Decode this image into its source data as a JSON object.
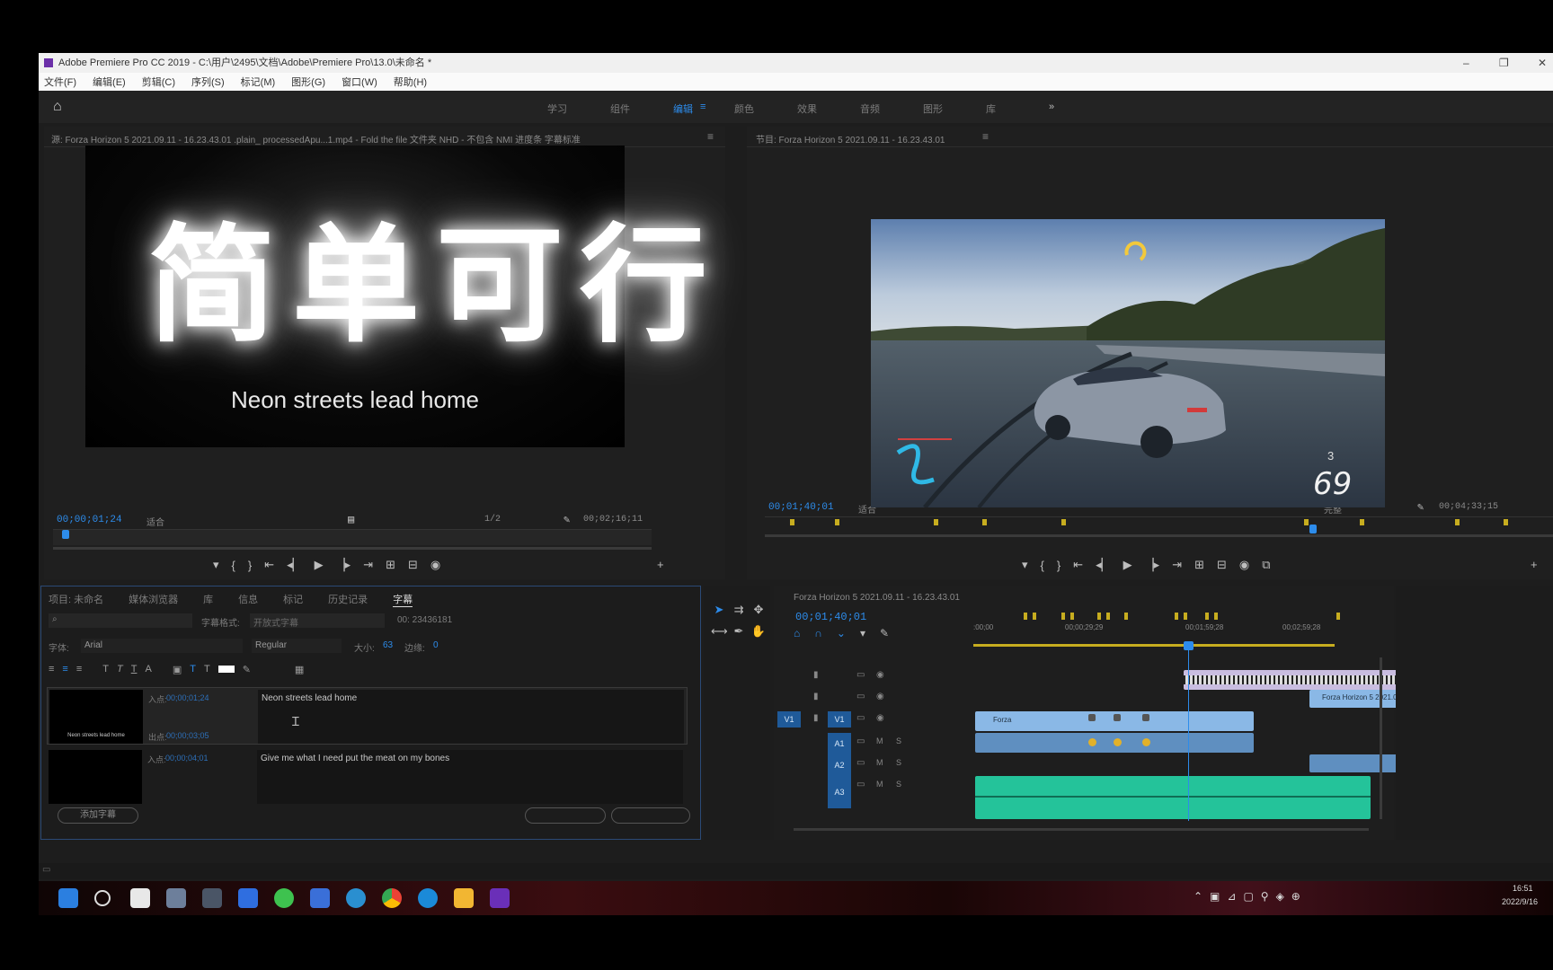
{
  "window": {
    "title": "Adobe Premiere Pro CC 2019 - C:\\用户\\2495\\文档\\Adobe\\Premiere Pro\\13.0\\未命名 *",
    "controls": [
      "–",
      "❐",
      "✕"
    ]
  },
  "menu": [
    "文件(F)",
    "编辑(E)",
    "剪辑(C)",
    "序列(S)",
    "标记(M)",
    "图形(G)",
    "窗口(W)",
    "帮助(H)"
  ],
  "workspaces": {
    "items": [
      "学习",
      "组件",
      "编辑",
      "颜色",
      "效果",
      "音频",
      "图形",
      "库"
    ],
    "active": "编辑",
    "more": "»"
  },
  "source": {
    "tab": "源: Forza Horizon 5 2021.09.11 - 16.23.43.01 .plain_ processedApu...1.mp4 - Fold the file 文件夹 NHD - 不包含 NMI 进度条 字幕标准",
    "close": "≡",
    "overlay_title": "简单可行",
    "caption": "Neon streets lead home",
    "timecode_left": "00;00;01;24",
    "fit": "适合",
    "quality": "1/2",
    "timecode_right": "00;02;16;11"
  },
  "program": {
    "tab": "节目: Forza Horizon 5 2021.09.11 - 16.23.43.01",
    "close": "≡",
    "timecode_left": "00;01;40;01",
    "fit": "适合",
    "quality": "完整",
    "timecode_right": "00;04;33;15",
    "hud_speed": "69",
    "hud_gear": "3"
  },
  "captions_panel": {
    "tabs": [
      "项目: 未命名",
      "媒体浏览器",
      "库",
      "信息",
      "标记",
      "历史记录",
      "字幕"
    ],
    "active_tab": "字幕",
    "search_placeholder": "",
    "filter_label": "字幕格式:",
    "filter_value": "开放式字幕",
    "timecode_display": "00: 23436181",
    "font_label": "字体:",
    "font_value": "Arial",
    "style_value": "Regular",
    "size_label": "大小:",
    "size_value": "63",
    "edge_label": "边缘:",
    "edge_value": "0",
    "rows": [
      {
        "in_label": "入点:",
        "in_tc": "00;00;01;24",
        "out_label": "出点:",
        "out_tc": "00;00;03;05",
        "text": "Neon streets lead home",
        "thumb_caption": "Neon streets lead home"
      },
      {
        "in_label": "入点:",
        "in_tc": "00;00;04;01",
        "out_label": "",
        "out_tc": "",
        "text": "Give me what I need put the meat on my bones",
        "thumb_caption": ""
      }
    ],
    "add_button": "添加字幕",
    "btn_a": "",
    "btn_b": ""
  },
  "timeline": {
    "tab": "Forza Horizon 5 2021.09.11 - 16.23.43.01",
    "timecode": "00;01;40;01",
    "ruler_labels": [
      ":00;00",
      "00;00;29;29",
      "00;01;59;28",
      "00;02;59;28"
    ],
    "track_labels": [
      "V1",
      "V1",
      "A1",
      "A2",
      "A3"
    ],
    "clip_v1_label": "Forza",
    "clip_v2_label": "Forza Horizon 5 2021.09.11"
  },
  "taskbar": {
    "time": "16:51",
    "date": "2022/9/16"
  },
  "colors": {
    "accent": "#2d8ceb",
    "video_clip": "#8ab8e6",
    "audio_clip": "#24c39a",
    "purple_clip": "#b9a6d9",
    "playhead": "#2d8ceb",
    "work_area": "#c7ad1f"
  }
}
